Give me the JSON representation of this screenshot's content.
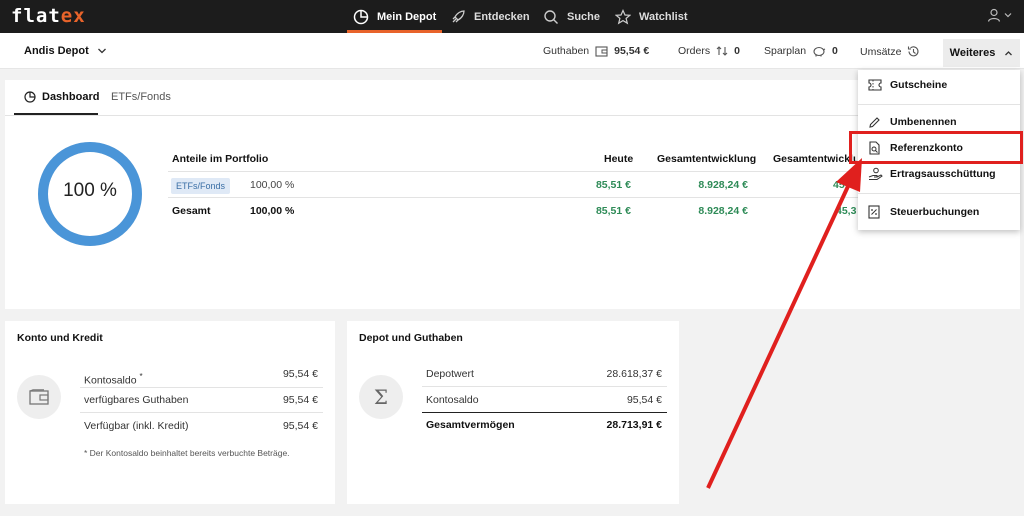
{
  "app": {
    "logo_a": "flat",
    "logo_b": "ex"
  },
  "nav": {
    "depot": "Mein Depot",
    "entdecken": "Entdecken",
    "suche": "Suche",
    "watchlist": "Watchlist"
  },
  "subbar": {
    "depot_name": "Andis Depot",
    "guthaben_label": "Guthaben",
    "guthaben_value": "95,54 €",
    "orders_label": "Orders",
    "orders_value": "0",
    "sparplan_label": "Sparplan",
    "sparplan_value": "0",
    "umsaetze_label": "Umsätze",
    "weiteres_label": "Weiteres"
  },
  "tabs": {
    "dashboard": "Dashboard",
    "etfs": "ETFs/Fonds"
  },
  "portfolio": {
    "donut_label": "100 %",
    "donut_fraction": 1.0,
    "headers": {
      "anteile": "Anteile im Portfolio",
      "heute": "Heute",
      "gesamt1": "Gesamtentwicklung",
      "gesamt2": "Gesamtentwicklun"
    },
    "rows": [
      {
        "category": "ETFs/Fonds",
        "percent": "100,00 %",
        "heute": "85,51 €",
        "gesamt": "8.928,24 €",
        "gesamt2": "45"
      },
      {
        "category": "Gesamt",
        "percent": "100,00 %",
        "heute": "85,51 €",
        "gesamt": "8.928,24 €",
        "gesamt2": "45,3"
      }
    ]
  },
  "konto": {
    "title": "Konto und Kredit",
    "rows": [
      {
        "label": "Kontosaldo",
        "sup": "*",
        "value": "95,54 €"
      },
      {
        "label": "verfügbares Guthaben",
        "value": "95,54 €"
      },
      {
        "label": "Verfügbar (inkl. Kredit)",
        "value": "95,54 €"
      }
    ],
    "footnote": "* Der Kontosaldo beinhaltet bereits verbuchte Beträge."
  },
  "depot_guthaben": {
    "title": "Depot und Guthaben",
    "rows": [
      {
        "label": "Depotwert",
        "value": "28.618,37 €"
      },
      {
        "label": "Kontosaldo",
        "value": "95,54 €"
      },
      {
        "label": "Gesamtvermögen",
        "value": "28.713,91 €"
      }
    ]
  },
  "menu": {
    "items": [
      {
        "label": "Gutscheine",
        "icon": "ticket-icon"
      },
      {
        "label": "Umbenennen",
        "icon": "pencil-icon"
      },
      {
        "label": "Referenzkonto",
        "icon": "document-search-icon"
      },
      {
        "label": "Ertragsausschüttung",
        "icon": "hand-coin-icon"
      },
      {
        "label": "Steuerbuchungen",
        "icon": "receipt-icon"
      }
    ]
  },
  "colors": {
    "accent": "#e8632a",
    "donut": "#4a95d8",
    "positive": "#2e8b57",
    "highlight": "#e0201e"
  }
}
